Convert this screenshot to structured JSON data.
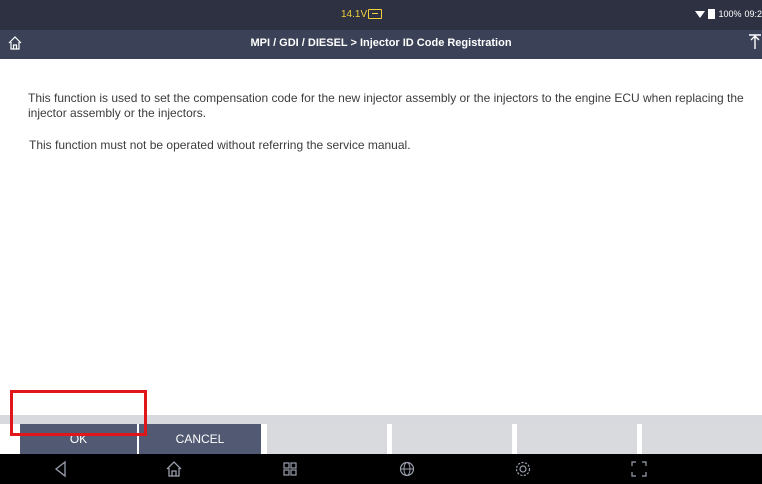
{
  "status_bar": {
    "voltage": "14.1V",
    "battery": "100%",
    "time": "09:2"
  },
  "header": {
    "title": "MPI / GDI / DIESEL > Injector ID Code Registration"
  },
  "content": {
    "message1": "This function is used to set the compensation code for the new injector assembly or the injectors to the engine ECU when replacing the injector assembly or the injectors.",
    "message2": "This function must not be operated without referring the service manual."
  },
  "buttons": {
    "ok_label": "OK",
    "cancel_label": "CANCEL"
  },
  "nav_bar": {
    "icons": [
      "back-icon",
      "home-icon",
      "recent-apps-icon",
      "globe-icon",
      "settings-icon",
      "screenshot-icon"
    ]
  },
  "colors": {
    "header_background": "#3b4257",
    "status_background": "#2d3142",
    "button_primary": "#525a73",
    "button_disabled": "#d8dade",
    "highlight": "#e0161b"
  }
}
